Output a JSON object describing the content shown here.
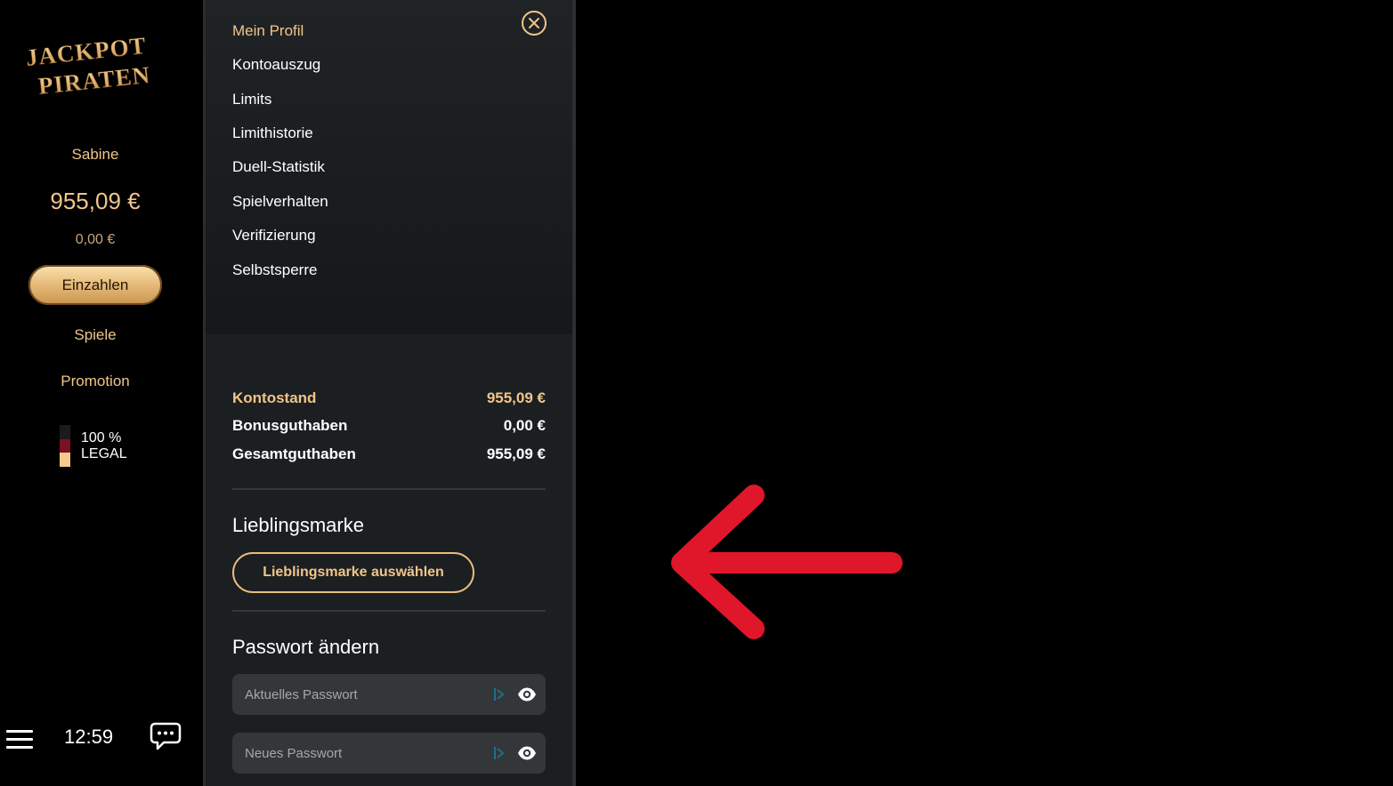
{
  "sidebar": {
    "logo_text": [
      "JACKPOT",
      "PIRATEN"
    ],
    "user_name": "Sabine",
    "balance": "955,09 €",
    "bonus_balance": "0,00 €",
    "deposit_label": "Einzahlen",
    "nav": [
      {
        "label": "Spiele"
      },
      {
        "label": "Promotion"
      }
    ],
    "legal_badge": {
      "line1": "100 %",
      "line2": "LEGAL"
    },
    "clock": "12:59"
  },
  "profile_menu": {
    "items": [
      {
        "label": "Mein Profil",
        "active": true
      },
      {
        "label": "Kontoauszug"
      },
      {
        "label": "Limits"
      },
      {
        "label": "Limithistorie"
      },
      {
        "label": "Duell-Statistik"
      },
      {
        "label": "Spielverhalten"
      },
      {
        "label": "Verifizierung"
      },
      {
        "label": "Selbstsperre"
      }
    ]
  },
  "balances": [
    {
      "label": "Kontostand",
      "value": "955,09 €"
    },
    {
      "label": "Bonusguthaben",
      "value": "0,00 €"
    },
    {
      "label": "Gesamtguthaben",
      "value": "955,09 €"
    }
  ],
  "favorite_brand": {
    "title": "Lieblingsmarke",
    "button_label": "Lieblingsmarke auswählen"
  },
  "change_password": {
    "title": "Passwort ändern",
    "fields": [
      {
        "placeholder": "Aktuelles Passwort"
      },
      {
        "placeholder": "Neues Passwort"
      }
    ]
  },
  "colors": {
    "accent_gold": "#f0c58a",
    "panel_bg": "#1c1f21",
    "annotation_red": "#e0162b"
  },
  "icons": [
    "hamburger-menu-icon",
    "chat-icon",
    "close-icon",
    "eye-icon",
    "password-manager-icon"
  ]
}
